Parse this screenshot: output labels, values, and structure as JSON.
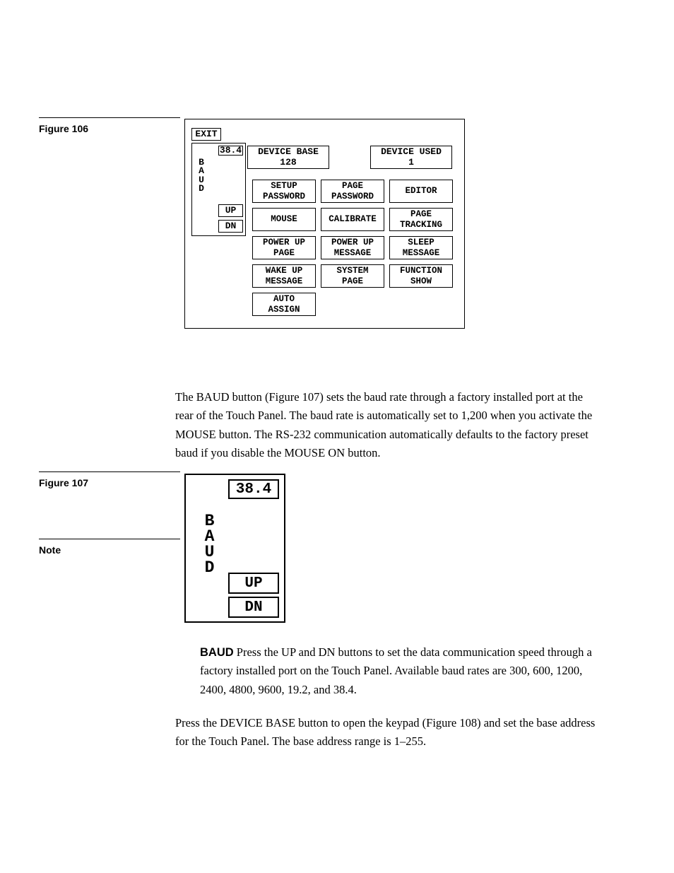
{
  "sidebar": {
    "fig106": "Figure 106",
    "fig107": "Figure 107",
    "note": "Note"
  },
  "panel": {
    "exit": "EXIT",
    "baud_label": [
      "B",
      "A",
      "U",
      "D"
    ],
    "baud_value": "38.4",
    "up": "UP",
    "dn": "DN",
    "device_base": "DEVICE BASE\n128",
    "device_used": "DEVICE USED\n1",
    "row1": [
      "SETUP\nPASSWORD",
      "PAGE\nPASSWORD",
      "EDITOR"
    ],
    "row2": [
      "MOUSE",
      "CALIBRATE",
      "PAGE\nTRACKING"
    ],
    "row3": [
      "POWER UP\nPAGE",
      "POWER UP\nMESSAGE",
      "SLEEP\nMESSAGE"
    ],
    "row4": [
      "WAKE UP\nMESSAGE",
      "SYSTEM\nPAGE",
      "FUNCTION\nSHOW"
    ],
    "row5": [
      "AUTO\nASSIGN"
    ]
  },
  "baud_big": {
    "value": "38.4",
    "up": "UP",
    "dn": "DN",
    "label": [
      "B",
      "A",
      "U",
      "D"
    ]
  },
  "body": {
    "p1": "The BAUD button (Figure 107) sets the baud rate through a factory installed port at the rear of the Touch Panel. The baud rate is automatically set to 1,200 when you activate the MOUSE button. The RS-232 communication automatically defaults to the factory preset baud if you disable the MOUSE ON button.",
    "p2_lead": "BAUD",
    "p2": "   Press the UP and DN buttons to set the data communication speed through a factory installed port on the Touch Panel. Available baud rates are 300, 600, 1200, 2400, 4800, 9600, 19.2, and 38.4.",
    "p3": "Press the DEVICE BASE button to open the keypad (Figure 108) and set the base address for the Touch Panel. The base address range is 1–255."
  }
}
